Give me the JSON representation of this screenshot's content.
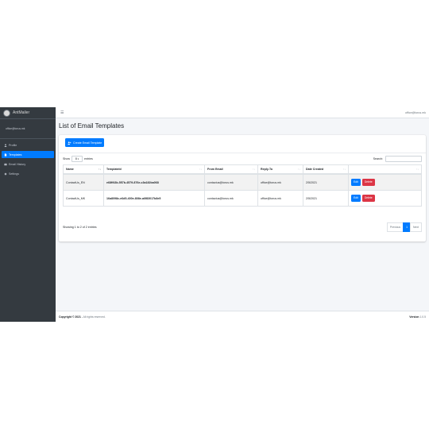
{
  "brand": {
    "name": "AntMailer"
  },
  "user": {
    "email": "office@torus.mk"
  },
  "sidebar": {
    "items": [
      {
        "label": "Profile",
        "icon": "user-icon",
        "active": false
      },
      {
        "label": "Templates",
        "icon": "file-icon",
        "active": true
      },
      {
        "label": "Email History",
        "icon": "envelope-icon",
        "active": false
      },
      {
        "label": "Settings",
        "icon": "gear-icon",
        "active": false
      }
    ]
  },
  "header": {
    "user_email": "office@torus.mk"
  },
  "main": {
    "title": "List of Email Templates",
    "create_button": "Create Email Template",
    "show_label": "Show",
    "entries_value": "8",
    "entries_label": "entries",
    "search_label": "Search:",
    "table": {
      "headers": [
        "Name",
        "TemplateId",
        "From Email",
        "Reply-To",
        "Date Created",
        ""
      ],
      "rows": [
        {
          "name": "ContactUs_EN",
          "template_id": "e68ff43b-557b-4579-876e-c3a182ba068",
          "from_email": "contactus@torus.mk",
          "reply_to": "office@torus.mk",
          "date_created": "2/5/2021",
          "edit": "Edit",
          "delete": "Delete"
        },
        {
          "name": "ContactUs_MK",
          "template_id": "16a8098c-e6d5-400e-808e-a6f83017b8e5",
          "from_email": "contactus@torus.mk",
          "reply_to": "office@torus.mk",
          "date_created": "2/5/2021",
          "edit": "Edit",
          "delete": "Delete"
        }
      ]
    },
    "info": "Showing 1 to 2 of 2 entries",
    "pagination": {
      "previous": "Previous",
      "current": "1",
      "next": "Next"
    }
  },
  "footer": {
    "copyright": "Copyright © 2021 .",
    "rights": "All rights reserved.",
    "version_label": "Version",
    "version": "1.0.5"
  },
  "colors": {
    "sidebar_bg": "#343a40",
    "accent": "#007bff",
    "danger": "#dc3545",
    "content_bg": "#f4f6f9"
  }
}
